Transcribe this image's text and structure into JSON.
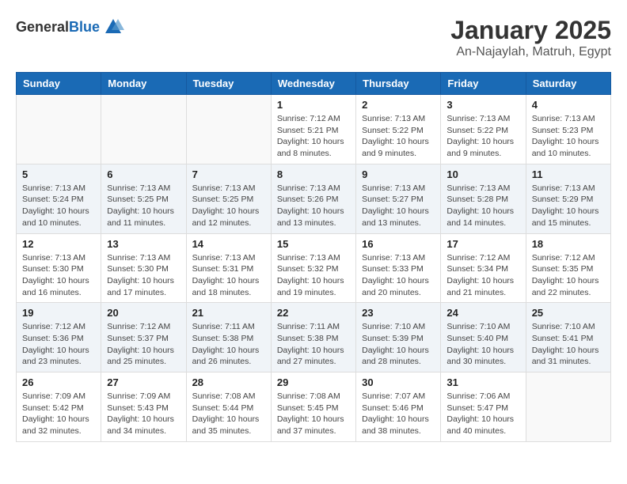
{
  "header": {
    "logo_general": "General",
    "logo_blue": "Blue",
    "month": "January 2025",
    "location": "An-Najaylah, Matruh, Egypt"
  },
  "weekdays": [
    "Sunday",
    "Monday",
    "Tuesday",
    "Wednesday",
    "Thursday",
    "Friday",
    "Saturday"
  ],
  "weeks": [
    [
      {
        "day": "",
        "info": ""
      },
      {
        "day": "",
        "info": ""
      },
      {
        "day": "",
        "info": ""
      },
      {
        "day": "1",
        "info": "Sunrise: 7:12 AM\nSunset: 5:21 PM\nDaylight: 10 hours\nand 8 minutes."
      },
      {
        "day": "2",
        "info": "Sunrise: 7:13 AM\nSunset: 5:22 PM\nDaylight: 10 hours\nand 9 minutes."
      },
      {
        "day": "3",
        "info": "Sunrise: 7:13 AM\nSunset: 5:22 PM\nDaylight: 10 hours\nand 9 minutes."
      },
      {
        "day": "4",
        "info": "Sunrise: 7:13 AM\nSunset: 5:23 PM\nDaylight: 10 hours\nand 10 minutes."
      }
    ],
    [
      {
        "day": "5",
        "info": "Sunrise: 7:13 AM\nSunset: 5:24 PM\nDaylight: 10 hours\nand 10 minutes."
      },
      {
        "day": "6",
        "info": "Sunrise: 7:13 AM\nSunset: 5:25 PM\nDaylight: 10 hours\nand 11 minutes."
      },
      {
        "day": "7",
        "info": "Sunrise: 7:13 AM\nSunset: 5:25 PM\nDaylight: 10 hours\nand 12 minutes."
      },
      {
        "day": "8",
        "info": "Sunrise: 7:13 AM\nSunset: 5:26 PM\nDaylight: 10 hours\nand 13 minutes."
      },
      {
        "day": "9",
        "info": "Sunrise: 7:13 AM\nSunset: 5:27 PM\nDaylight: 10 hours\nand 13 minutes."
      },
      {
        "day": "10",
        "info": "Sunrise: 7:13 AM\nSunset: 5:28 PM\nDaylight: 10 hours\nand 14 minutes."
      },
      {
        "day": "11",
        "info": "Sunrise: 7:13 AM\nSunset: 5:29 PM\nDaylight: 10 hours\nand 15 minutes."
      }
    ],
    [
      {
        "day": "12",
        "info": "Sunrise: 7:13 AM\nSunset: 5:30 PM\nDaylight: 10 hours\nand 16 minutes."
      },
      {
        "day": "13",
        "info": "Sunrise: 7:13 AM\nSunset: 5:30 PM\nDaylight: 10 hours\nand 17 minutes."
      },
      {
        "day": "14",
        "info": "Sunrise: 7:13 AM\nSunset: 5:31 PM\nDaylight: 10 hours\nand 18 minutes."
      },
      {
        "day": "15",
        "info": "Sunrise: 7:13 AM\nSunset: 5:32 PM\nDaylight: 10 hours\nand 19 minutes."
      },
      {
        "day": "16",
        "info": "Sunrise: 7:13 AM\nSunset: 5:33 PM\nDaylight: 10 hours\nand 20 minutes."
      },
      {
        "day": "17",
        "info": "Sunrise: 7:12 AM\nSunset: 5:34 PM\nDaylight: 10 hours\nand 21 minutes."
      },
      {
        "day": "18",
        "info": "Sunrise: 7:12 AM\nSunset: 5:35 PM\nDaylight: 10 hours\nand 22 minutes."
      }
    ],
    [
      {
        "day": "19",
        "info": "Sunrise: 7:12 AM\nSunset: 5:36 PM\nDaylight: 10 hours\nand 23 minutes."
      },
      {
        "day": "20",
        "info": "Sunrise: 7:12 AM\nSunset: 5:37 PM\nDaylight: 10 hours\nand 25 minutes."
      },
      {
        "day": "21",
        "info": "Sunrise: 7:11 AM\nSunset: 5:38 PM\nDaylight: 10 hours\nand 26 minutes."
      },
      {
        "day": "22",
        "info": "Sunrise: 7:11 AM\nSunset: 5:38 PM\nDaylight: 10 hours\nand 27 minutes."
      },
      {
        "day": "23",
        "info": "Sunrise: 7:10 AM\nSunset: 5:39 PM\nDaylight: 10 hours\nand 28 minutes."
      },
      {
        "day": "24",
        "info": "Sunrise: 7:10 AM\nSunset: 5:40 PM\nDaylight: 10 hours\nand 30 minutes."
      },
      {
        "day": "25",
        "info": "Sunrise: 7:10 AM\nSunset: 5:41 PM\nDaylight: 10 hours\nand 31 minutes."
      }
    ],
    [
      {
        "day": "26",
        "info": "Sunrise: 7:09 AM\nSunset: 5:42 PM\nDaylight: 10 hours\nand 32 minutes."
      },
      {
        "day": "27",
        "info": "Sunrise: 7:09 AM\nSunset: 5:43 PM\nDaylight: 10 hours\nand 34 minutes."
      },
      {
        "day": "28",
        "info": "Sunrise: 7:08 AM\nSunset: 5:44 PM\nDaylight: 10 hours\nand 35 minutes."
      },
      {
        "day": "29",
        "info": "Sunrise: 7:08 AM\nSunset: 5:45 PM\nDaylight: 10 hours\nand 37 minutes."
      },
      {
        "day": "30",
        "info": "Sunrise: 7:07 AM\nSunset: 5:46 PM\nDaylight: 10 hours\nand 38 minutes."
      },
      {
        "day": "31",
        "info": "Sunrise: 7:06 AM\nSunset: 5:47 PM\nDaylight: 10 hours\nand 40 minutes."
      },
      {
        "day": "",
        "info": ""
      }
    ]
  ]
}
